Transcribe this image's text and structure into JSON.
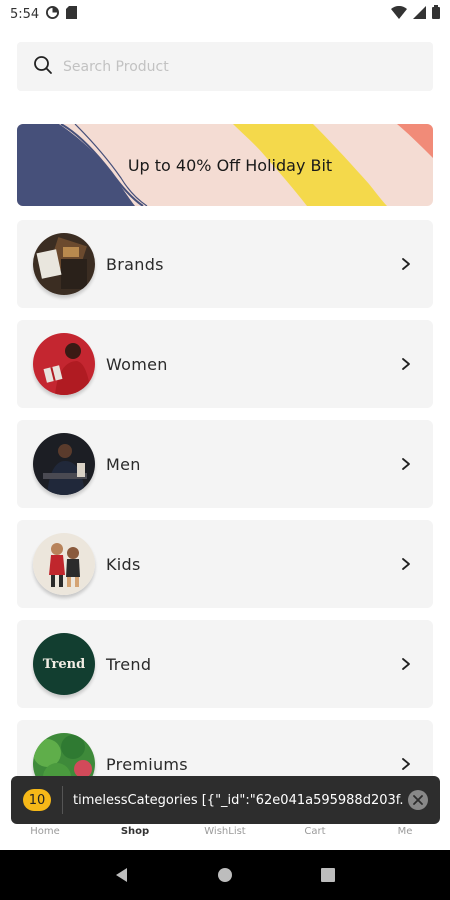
{
  "status_bar": {
    "time": "5:54"
  },
  "search": {
    "placeholder": "Search Product"
  },
  "banner": {
    "text": "Up to 40% Off Holiday Bit"
  },
  "categories": [
    {
      "label": "Brands"
    },
    {
      "label": "Women"
    },
    {
      "label": "Men"
    },
    {
      "label": "Kids"
    },
    {
      "label": "Trend",
      "image_text": "Trend"
    },
    {
      "label": "Premiums"
    }
  ],
  "toast": {
    "badge": "10",
    "message": "timelessCategories [{\"_id\":\"62e041a595988d203f..."
  },
  "bottom_nav": {
    "items": [
      "Home",
      "Shop",
      "WishList",
      "Cart",
      "Me"
    ],
    "active": "Shop"
  }
}
